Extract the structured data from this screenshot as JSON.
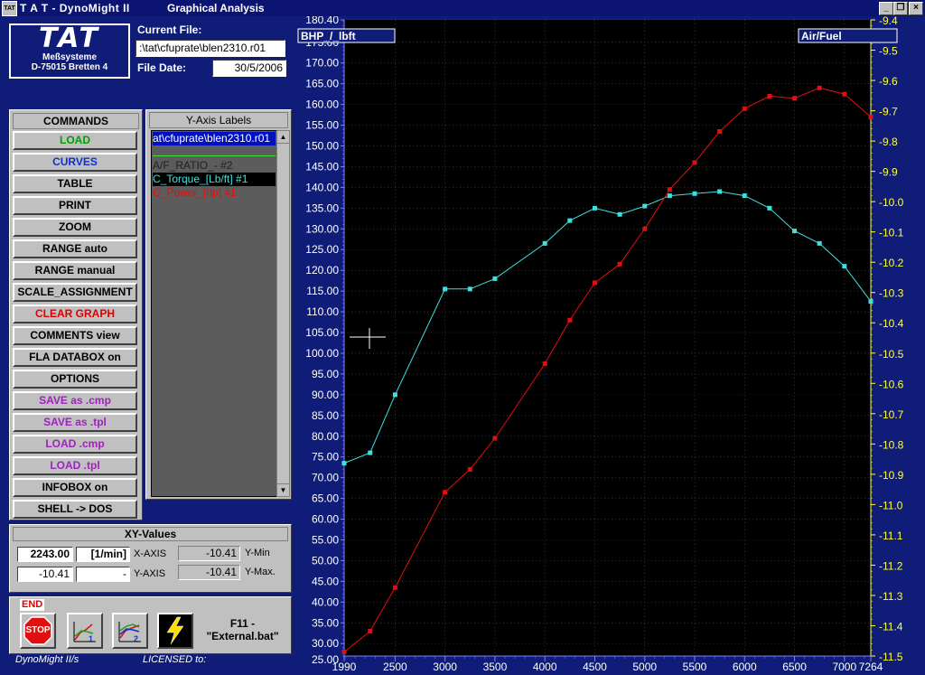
{
  "window": {
    "app_title": "T A T - DynoMight II",
    "subtitle": "Graphical Analysis",
    "icon_label": "TAT",
    "minimize": "_",
    "restore": "❐",
    "close": "×"
  },
  "logo": {
    "brand": "TAT",
    "line1": "Meßsysteme",
    "line2": "D-75015 Bretten 4"
  },
  "file": {
    "current_label": "Current File:",
    "current_value": ":\\tat\\cfuprate\\blen2310.r01",
    "date_label": "File Date:",
    "date_value": "30/5/2006"
  },
  "commands": {
    "header": "COMMANDS",
    "items": [
      {
        "label": "LOAD",
        "color": "#00a000"
      },
      {
        "label": "CURVES",
        "color": "#1030d0"
      },
      {
        "label": "TABLE",
        "color": "#000000"
      },
      {
        "label": "PRINT",
        "color": "#000000"
      },
      {
        "label": "ZOOM",
        "color": "#000000"
      },
      {
        "label": "RANGE    auto",
        "color": "#000000"
      },
      {
        "label": "RANGE manual",
        "color": "#000000"
      },
      {
        "label": "SCALE_ASSIGNMENT",
        "color": "#000000"
      },
      {
        "label": "CLEAR GRAPH",
        "color": "#e00000"
      },
      {
        "label": "COMMENTS  view",
        "color": "#000000"
      },
      {
        "label": "FLA DATABOX  on",
        "color": "#000000"
      },
      {
        "label": "OPTIONS",
        "color": "#000000"
      },
      {
        "label": "SAVE  as .cmp",
        "color": "#a020c0"
      },
      {
        "label": "SAVE  as  .tpl",
        "color": "#a020c0"
      },
      {
        "label": "LOAD  .cmp",
        "color": "#a020c0"
      },
      {
        "label": "LOAD  .tpl",
        "color": "#a020c0"
      },
      {
        "label": "INFOBOX on",
        "color": "#000000"
      },
      {
        "label": "SHELL -> DOS",
        "color": "#000000"
      }
    ]
  },
  "y_axis_labels": {
    "header": "Y-Axis Labels",
    "selected_file": "at\\cfuprate\\blen2310.r01",
    "items": [
      {
        "label": "A/F_RATIO_- #2",
        "color": "#202020"
      },
      {
        "label": "C_Torque_[Lb/ft] #1",
        "color": "#40e0e0"
      },
      {
        "label": "C_Power_[hp] #1",
        "color": "#e01010"
      }
    ],
    "scroll_up": "▲",
    "scroll_down": "▼"
  },
  "xy_values": {
    "header": "XY-Values",
    "x_value": "2243.00",
    "x_unit": "[1/min]",
    "x_axis_label": "X-AXIS",
    "y_value": "-10.41",
    "y_unit": "-",
    "y_axis_label": "Y-AXIS",
    "ymin_value": "-10.41",
    "ymin_label": "Y-Min",
    "ymax_value": "-10.41",
    "ymax_label": "Y-Max."
  },
  "bottom": {
    "end_label": "END",
    "stop_label": "STOP",
    "chart1_label": "1",
    "chart2_label": "2",
    "f11_line1": "F11 -",
    "f11_line2": "\"External.bat\""
  },
  "footer": {
    "left": "DynoMight II/s",
    "right": "LICENSED to:"
  },
  "chart_data": {
    "type": "line",
    "left_axis_label": "BHP_/_lbft",
    "right_axis_label": "Air/Fuel",
    "xlim": [
      1990,
      7264
    ],
    "ylim_left": [
      27,
      180.4
    ],
    "ylim_right": [
      -11.5,
      -9.4
    ],
    "x_ticks": [
      "1990",
      "2500",
      "3000",
      "3500",
      "4000",
      "4500",
      "5000",
      "5500",
      "6000",
      "6500",
      "7000",
      "7264"
    ],
    "y_ticks_left": [
      "180.40",
      "175.00",
      "170.00",
      "165.00",
      "160.00",
      "155.00",
      "150.00",
      "145.00",
      "140.00",
      "135.00",
      "130.00",
      "125.00",
      "120.00",
      "115.00",
      "110.00",
      "105.00",
      "100.00",
      "95.00",
      "90.00",
      "85.00",
      "80.00",
      "75.00",
      "70.00",
      "65.00",
      "60.00",
      "55.00",
      "50.00",
      "45.00",
      "40.00",
      "35.00",
      "30.00",
      "25.00"
    ],
    "y_ticks_right": [
      "-9.4",
      "-9.5",
      "-9.6",
      "-9.7",
      "-9.8",
      "-9.9",
      "-10.0",
      "-10.1",
      "-10.2",
      "-10.3",
      "-10.4",
      "-10.5",
      "-10.6",
      "-10.7",
      "-10.8",
      "-10.9",
      "-11.0",
      "-11.1",
      "-11.2",
      "-11.3",
      "-11.4",
      "-11.5"
    ],
    "grid": true,
    "series": [
      {
        "name": "C_Torque_[Lb/ft] #1",
        "color": "#40e0e0",
        "x": [
          1990,
          2250,
          2500,
          3000,
          3250,
          3500,
          4000,
          4250,
          4500,
          4750,
          5000,
          5250,
          5500,
          5750,
          6000,
          6250,
          6500,
          6750,
          7000,
          7264
        ],
        "y": [
          73.5,
          76,
          90,
          115.5,
          115.5,
          118,
          126.5,
          132,
          135,
          133.5,
          135.5,
          138,
          138.5,
          139,
          138,
          135,
          129.5,
          126.5,
          121,
          112.5
        ]
      },
      {
        "name": "C_Power_[hp] #1",
        "color": "#e01010",
        "x": [
          1990,
          2250,
          2500,
          3000,
          3250,
          3500,
          4000,
          4250,
          4500,
          4750,
          5000,
          5250,
          5500,
          5750,
          6000,
          6250,
          6500,
          6750,
          7000,
          7264
        ],
        "y": [
          28,
          33,
          43.5,
          66.5,
          72,
          79.5,
          97.5,
          108,
          117,
          121.5,
          130,
          139.5,
          146,
          153.5,
          159,
          162,
          161.5,
          164,
          162.5,
          157
        ]
      }
    ]
  }
}
